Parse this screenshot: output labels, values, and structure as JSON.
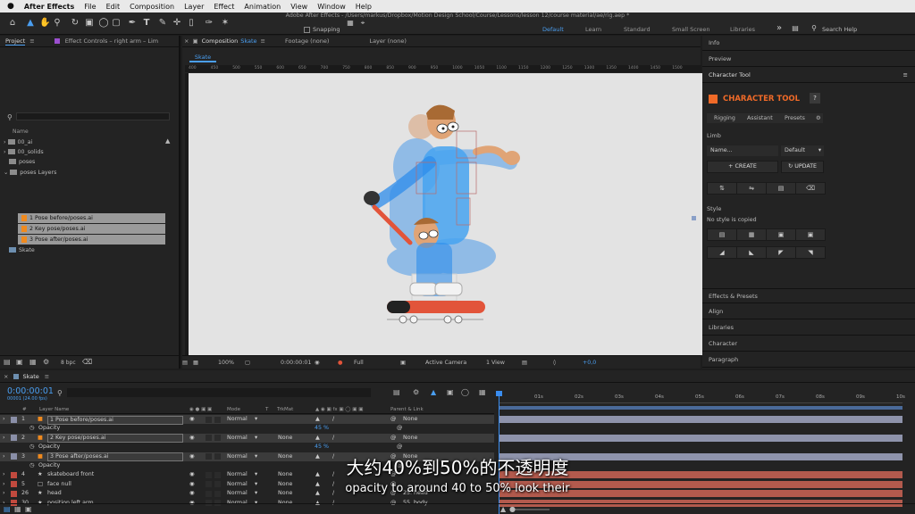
{
  "mac_menu": {
    "app": "After Effects",
    "items": [
      "File",
      "Edit",
      "Composition",
      "Layer",
      "Effect",
      "Animation",
      "View",
      "Window",
      "Help"
    ]
  },
  "window_title": "Adobe After Effects - /Users/markus/Dropbox/Motion Design School/Course/Lessons/lesson 12/course material/ae/rig.aep *",
  "toolbar": {
    "snapping": "Snapping",
    "workspaces": [
      "Default",
      "Learn",
      "Standard",
      "Small Screen",
      "Libraries"
    ],
    "search_placeholder": "Search Help"
  },
  "project_panel": {
    "tab_project": "Project",
    "tab_effects": "Effect Controls – right arm – Lim",
    "name_header": "Name",
    "bpc": "8 bpc",
    "items": [
      {
        "label": "00_ai",
        "type": "folder"
      },
      {
        "label": "00_solids",
        "type": "folder"
      },
      {
        "label": "poses",
        "type": "folder"
      },
      {
        "label": "poses Layers",
        "type": "folder"
      },
      {
        "label": "1 Pose before/poses.ai",
        "type": "ai"
      },
      {
        "label": "2 Key pose/poses.ai",
        "type": "ai"
      },
      {
        "label": "3 Pose after/poses.ai",
        "type": "ai"
      },
      {
        "label": "Skate",
        "type": "comp"
      }
    ]
  },
  "composition_panel": {
    "tab": "Composition",
    "tab_name": "Skate",
    "footage": "Footage (none)",
    "layer": "Layer (none)",
    "comp_tab": "Skate",
    "ruler": [
      "400",
      "450",
      "500",
      "550",
      "600",
      "650",
      "700",
      "750",
      "800",
      "850",
      "900",
      "950",
      "1000",
      "1050",
      "1100",
      "1150",
      "1200",
      "1250",
      "1300",
      "1350",
      "1400",
      "1450",
      "1500"
    ],
    "footer": {
      "zoom": "100%",
      "time": "0:00:00:01",
      "resolution": "Full",
      "camera": "Active Camera",
      "views": "1 View",
      "exposure": "+0,0"
    }
  },
  "right_panel": {
    "info": "Info",
    "preview": "Preview",
    "tab": "Character Tool",
    "brand": "CHARACTER TOOL",
    "help": "?",
    "tabs": [
      "Rigging",
      "Assistant",
      "Presets"
    ],
    "limb_label": "Limb",
    "name_placeholder": "Name...",
    "style_select": "Default",
    "create": "CREATE",
    "update": "UPDATE",
    "style_label": "Style",
    "no_style": "No style is copied",
    "sections": [
      "Effects & Presets",
      "Align",
      "Libraries",
      "Character",
      "Paragraph"
    ]
  },
  "timeline": {
    "tab": "Skate",
    "timecode": "0:00:00:01",
    "fps": "00001 (24.00 fps)",
    "headers": {
      "num": "#",
      "name": "Layer Name",
      "mode": "Mode",
      "t": "T",
      "trkmat": "TrkMat",
      "parent": "Parent & Link"
    },
    "ruler": [
      "01s",
      "02s",
      "03s",
      "04s",
      "05s",
      "06s",
      "07s",
      "08s",
      "09s",
      "10s"
    ],
    "layers": [
      {
        "num": "1",
        "name": "1 Pose before/poses.ai",
        "mode": "Normal",
        "trkmat": "",
        "parent": "None",
        "color": "#8a8fa8",
        "icon": "ai",
        "boxed": true
      },
      {
        "sub": true,
        "label": "Opacity",
        "value": "45 %"
      },
      {
        "num": "2",
        "name": "2 Key pose/poses.ai",
        "mode": "Normal",
        "trkmat": "None",
        "parent": "None",
        "color": "#8a8fa8",
        "icon": "ai",
        "boxed": true
      },
      {
        "sub": true,
        "label": "Opacity",
        "value": "45 %"
      },
      {
        "num": "3",
        "name": "3 Pose after/poses.ai",
        "mode": "Normal",
        "trkmat": "None",
        "parent": "None",
        "color": "#8a8fa8",
        "icon": "ai",
        "boxed": true
      },
      {
        "sub": true,
        "label": "Opacity",
        "value": ""
      },
      {
        "num": "4",
        "name": "skateboard front",
        "mode": "Normal",
        "trkmat": "None",
        "parent": "",
        "color": "#c24a3e",
        "icon": "star",
        "boxed": false
      },
      {
        "num": "5",
        "name": "face null",
        "mode": "Normal",
        "trkmat": "None",
        "parent": "",
        "color": "#c24a3e",
        "icon": "square",
        "boxed": false
      },
      {
        "num": "26",
        "name": "head",
        "mode": "Normal",
        "trkmat": "None",
        "parent": "25. head",
        "color": "#c24a3e",
        "icon": "star",
        "boxed": false
      },
      {
        "num": "30",
        "name": "position left arm",
        "mode": "Normal",
        "trkmat": "None",
        "parent": "55. body",
        "color": "#c24a3e",
        "icon": "star",
        "boxed": false
      }
    ]
  },
  "subtitle": {
    "zh": "大约40%到50%的不透明度",
    "en": "opacity to around 40 to 50% look their"
  },
  "colors": {
    "accent": "#2d8ceb",
    "brand": "#f06a28",
    "playhead": "#3a8df0"
  }
}
